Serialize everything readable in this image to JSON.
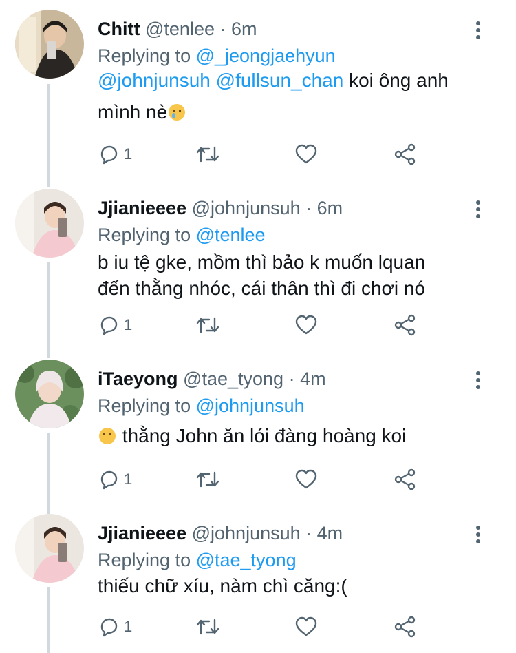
{
  "tweets": [
    {
      "name": "Chitt",
      "handle": "@tenlee",
      "time": "6m",
      "replying_prefix": "Replying to ",
      "replying_to": "@_jeongjaehyun",
      "body_lines": [
        {
          "mentions": "@johnjunsuh @fullsun_chan",
          "text": " koi ông anh"
        },
        {
          "text": "mình nè"
        }
      ],
      "emoji": "crying-face-emoji",
      "reply_count": "1"
    },
    {
      "name": "Jjianieeee",
      "handle": "@johnjunsuh",
      "time": "6m",
      "replying_prefix": "Replying to ",
      "replying_to": "@tenlee",
      "body_lines": [
        {
          "text": "b iu tệ gke, mồm thì bảo k muốn lquan"
        },
        {
          "text": "đến thằng nhóc, cái thân thì đi chơi nó"
        }
      ],
      "reply_count": "1"
    },
    {
      "name": "iTaeyong",
      "handle": "@tae_tyong",
      "time": "4m",
      "replying_prefix": "Replying to ",
      "replying_to": "@johnjunsuh",
      "body_lines": [
        {
          "text": " thằng John ăn lói đàng hoàng koi"
        }
      ],
      "emoji": "slightly-smiling-face-emoji",
      "reply_count": "1"
    },
    {
      "name": "Jjianieeee",
      "handle": "@johnjunsuh",
      "time": "4m",
      "replying_prefix": "Replying to ",
      "replying_to": "@tae_tyong",
      "body_lines": [
        {
          "text": "thiếu chữ xíu, nàm chì căng:("
        }
      ],
      "reply_count": "1"
    }
  ],
  "separator": " · ",
  "icons": [
    "reply-icon",
    "retweet-icon",
    "like-icon",
    "share-icon",
    "more-icon"
  ],
  "colors": {
    "link": "#1d9bf0",
    "muted": "#536471",
    "thread_line": "#cfd9de"
  }
}
